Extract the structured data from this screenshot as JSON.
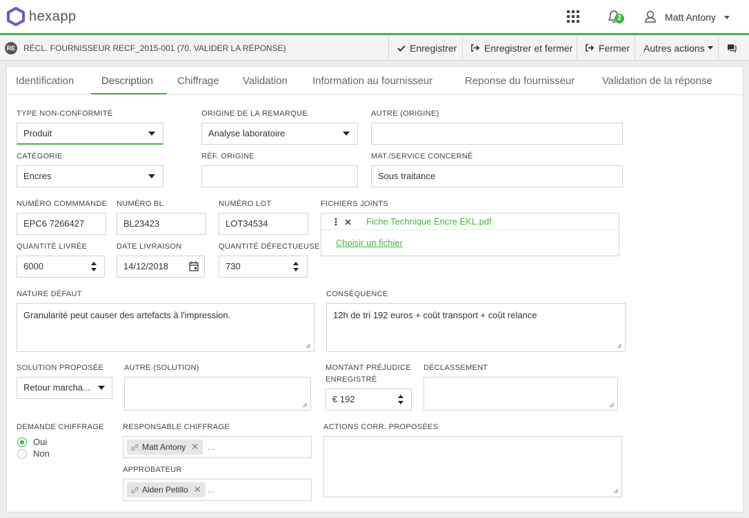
{
  "app": {
    "name": "hexapp",
    "brand_color": "#3eb83a",
    "logo_color": "#6b57c9"
  },
  "header": {
    "notifications_count": "2",
    "user_name": "Matt Antony"
  },
  "record": {
    "badge": "RE",
    "title": "RÉCL. FOURNISSEUR RECF_2015-001 (70. VALIDER LA RÉPONSE)"
  },
  "toolbar": {
    "save": "Enregistrer",
    "save_close": "Enregistrer et fermer",
    "close": "Fermer",
    "more": "Autres actions"
  },
  "tabs": [
    "Identification",
    "Description",
    "Chiffrage",
    "Validation",
    "Information au fournisseur",
    "Reponse du fournisseur",
    "Validation de la réponse"
  ],
  "active_tab": "Description",
  "form": {
    "type_nc": {
      "label": "TYPE NON-CONFORMITÉ",
      "value": "Produit"
    },
    "origine": {
      "label": "ORIGINE DE LA REMARQUE",
      "value": "Analyse laboratoire"
    },
    "autre_origine": {
      "label": "AUTRE (ORIGINE)",
      "value": ""
    },
    "categorie": {
      "label": "CATÉGORIE",
      "value": "Encres"
    },
    "ref_origine": {
      "label": "RÉF. ORIGINE",
      "value": ""
    },
    "mat_service": {
      "label": "MAT./SERVICE CONCERNÉ",
      "value": "Sous traitance"
    },
    "num_commande": {
      "label": "NUMÉRO COMMMANDE",
      "value": "EPC6 7266427"
    },
    "num_bl": {
      "label": "NUMÉRO BL",
      "value": "BL23423"
    },
    "num_lot": {
      "label": "NUMÉRO LOT",
      "value": "LOT34534"
    },
    "fichiers": {
      "label": "FICHIERS JOINTS",
      "file_name": "Fiche Technique Encre EKL.pdf",
      "choose": "Choisir un fichier"
    },
    "qte_livree": {
      "label": "QUANTITÉ LIVRÉE",
      "value": "6000"
    },
    "date_livraison": {
      "label": "DATE LIVRAISON",
      "value": "14/12/2018"
    },
    "qte_defect": {
      "label": "QUANTITÉ DÉFECTUEUSE",
      "value": "730"
    },
    "nature_defaut": {
      "label": "NATURE DÉFAUT",
      "value": "Granularité peut causer des artefacts à l'impression."
    },
    "consequence": {
      "label": "CONSÉQUENCE",
      "value": "12h de tri 192 euros + coût transport + coût relance"
    },
    "solution": {
      "label": "SOLUTION PROPOSÉE",
      "value": "Retour marcha..."
    },
    "autre_solution": {
      "label": "AUTRE (SOLUTION)",
      "value": ""
    },
    "montant": {
      "label1": "MONTANT PRÉJUDICE",
      "label2": "ENREGISTRÉ",
      "value": "€ 192"
    },
    "declassement": {
      "label": "DÉCLASSEMENT",
      "value": ""
    },
    "demande_chiffrage": {
      "label": "DEMANDE CHIFFRAGE",
      "oui": "Oui",
      "non": "Non",
      "selected": "Oui"
    },
    "responsable": {
      "label": "RESPONSABLE CHIFFRAGE",
      "tag": "Matt Antony",
      "more": "..."
    },
    "approbateur": {
      "label": "APPROBATEUR",
      "tag": "Alden Petillo",
      "more": "..."
    },
    "actions_corr": {
      "label": "ACTIONS CORR. PROPOSÉES",
      "value": ""
    }
  }
}
